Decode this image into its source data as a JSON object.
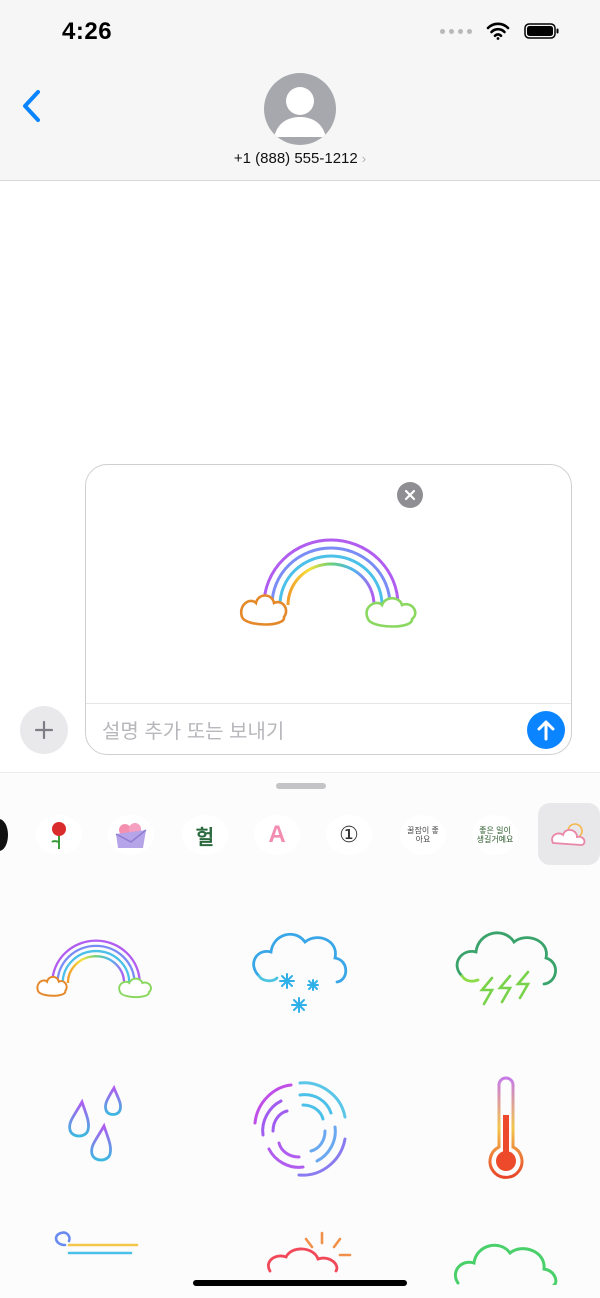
{
  "status_bar": {
    "time": "4:26",
    "icons": [
      "signal-dots-icon",
      "wifi-icon",
      "battery-icon"
    ]
  },
  "header": {
    "back_icon": "chevron-left-icon",
    "contact_name": "+1 (888) 555-1212",
    "contact_chevron": "›"
  },
  "compose": {
    "add_icon": "plus-icon",
    "attached_sticker": "rainbow-sticker",
    "remove_icon": "close-icon",
    "placeholder": "설명 추가 또는 보내기",
    "send_icon": "arrow-up-icon"
  },
  "sticker_drawer": {
    "packs": [
      {
        "name": "rose",
        "icon": "rose-icon"
      },
      {
        "name": "flowers-envelope",
        "icon": "envelope-icon"
      },
      {
        "name": "korean-text",
        "icon": "hangul-sticker-icon",
        "text": "헐"
      },
      {
        "name": "letter-a",
        "icon": "letter-a-icon",
        "text": "A"
      },
      {
        "name": "number-one",
        "icon": "circled-one-icon",
        "text": "①"
      },
      {
        "name": "korean-phrase-1",
        "icon": "korean-phrase-icon",
        "text": "꿀잠이 좋아요"
      },
      {
        "name": "korean-phrase-2",
        "icon": "korean-phrase-icon",
        "text": "좋은 일이 생길거예요"
      },
      {
        "name": "weather",
        "icon": "cloud-sun-icon",
        "selected": true
      }
    ],
    "stickers": [
      "rainbow-sticker",
      "snow-cloud-sticker",
      "thunder-cloud-sticker",
      "raindrops-sticker",
      "swirl-sticker",
      "thermometer-sticker",
      "wind-sticker",
      "sun-cloud-sticker",
      "cloud-sticker"
    ]
  },
  "colors": {
    "accent": "#0A84FF",
    "header_bg": "#F6F6F6",
    "avatar": "#A7A8AD",
    "placeholder": "#B7B7BC"
  }
}
